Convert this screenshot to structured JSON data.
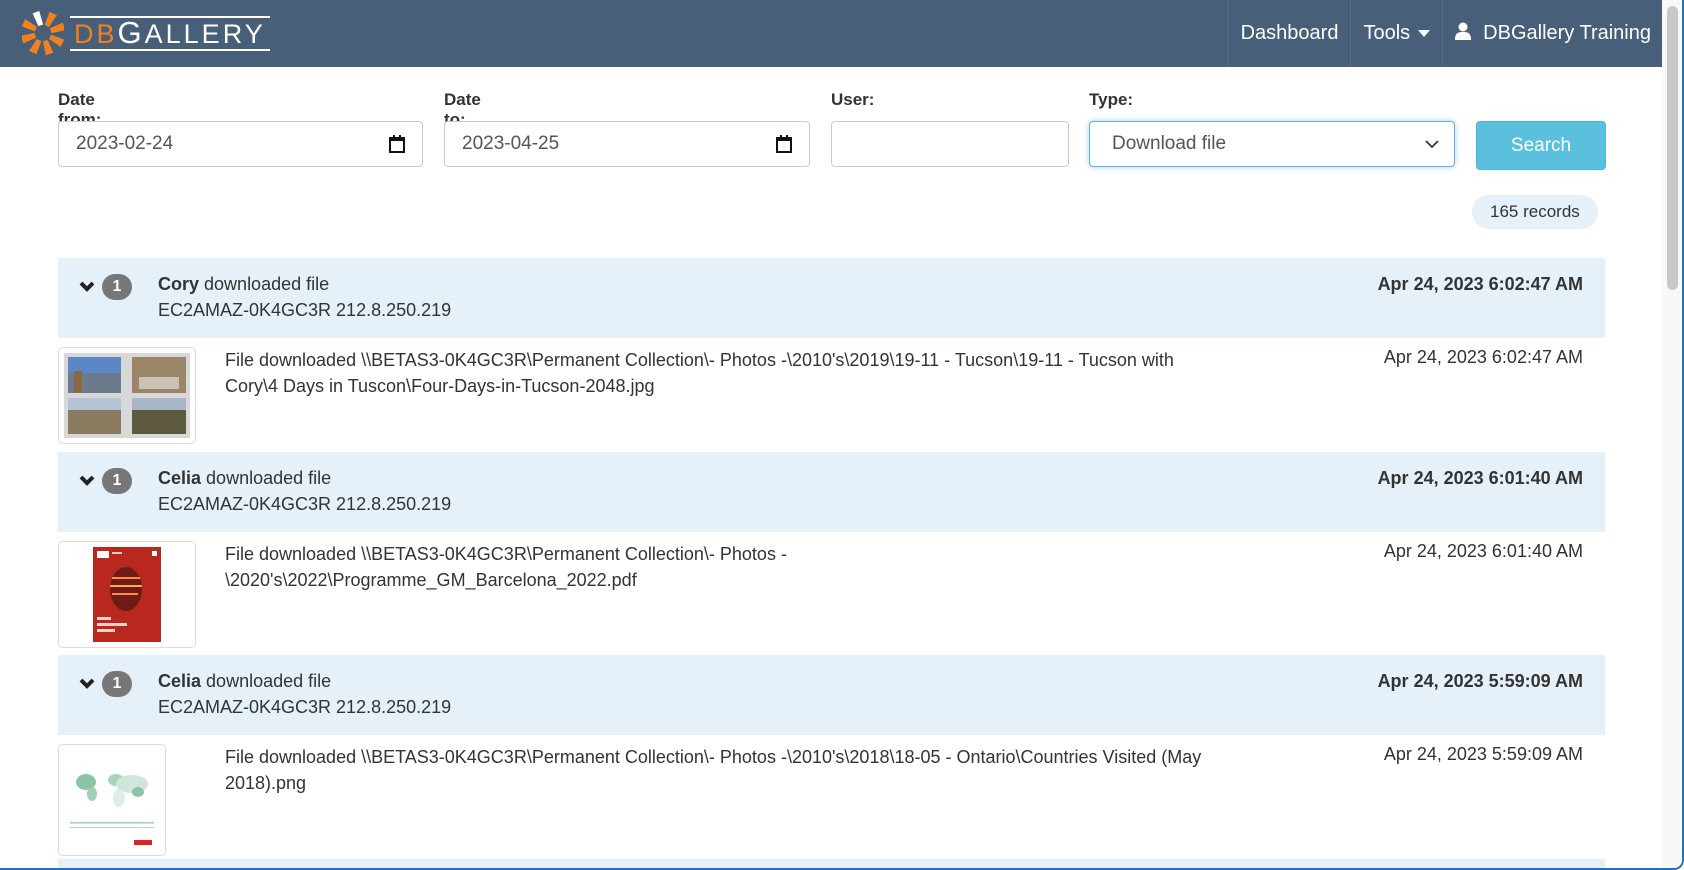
{
  "navbar": {
    "brand_prefix": "DB",
    "brand_rest_big": "G",
    "brand_rest": "ALLERY",
    "items": [
      {
        "label": "Dashboard",
        "icon": null
      },
      {
        "label": "Tools",
        "icon": "caret-down-icon"
      },
      {
        "label": "DBGallery Training",
        "icon": "user-icon"
      }
    ]
  },
  "filters": {
    "date_from": {
      "label": "Date from:",
      "value": "2023-02-24"
    },
    "date_to": {
      "label": "Date to:",
      "value": "2023-04-25"
    },
    "user": {
      "label": "User:",
      "value": ""
    },
    "type": {
      "label": "Type:",
      "value": "Download file"
    },
    "search_label": "Search"
  },
  "records_count": "165 records",
  "entries": [
    {
      "count": "1",
      "user": "Cory",
      "action": "downloaded file",
      "machine": "EC2AMAZ-0K4GC3R 212.8.250.219",
      "time": "Apr 24, 2023 6:02:47 AM",
      "detail": "File downloaded \\\\BETAS3-0K4GC3R\\Permanent Collection\\- Photos -\\2010's\\2019\\19-11 - Tucson\\19-11 - Tucson with Cory\\4 Days in Tuscon\\Four-Days-in-Tucson-2048.jpg",
      "detail_time": "Apr 24, 2023 6:02:47 AM",
      "thumb": "photo-collage"
    },
    {
      "count": "1",
      "user": "Celia",
      "action": "downloaded file",
      "machine": "EC2AMAZ-0K4GC3R 212.8.250.219",
      "time": "Apr 24, 2023 6:01:40 AM",
      "detail": "File downloaded \\\\BETAS3-0K4GC3R\\Permanent Collection\\- Photos -\\2020's\\2022\\Programme_GM_Barcelona_2022.pdf",
      "detail_time": "Apr 24, 2023 6:01:40 AM",
      "thumb": "pdf-cover"
    },
    {
      "count": "1",
      "user": "Celia",
      "action": "downloaded file",
      "machine": "EC2AMAZ-0K4GC3R 212.8.250.219",
      "time": "Apr 24, 2023 5:59:09 AM",
      "detail": "File downloaded \\\\BETAS3-0K4GC3R\\Permanent Collection\\- Photos -\\2010's\\2018\\18-05 - Ontario\\Countries Visited (May 2018).png",
      "detail_time": "Apr 24, 2023 5:59:09 AM",
      "thumb": "world-map"
    }
  ]
}
